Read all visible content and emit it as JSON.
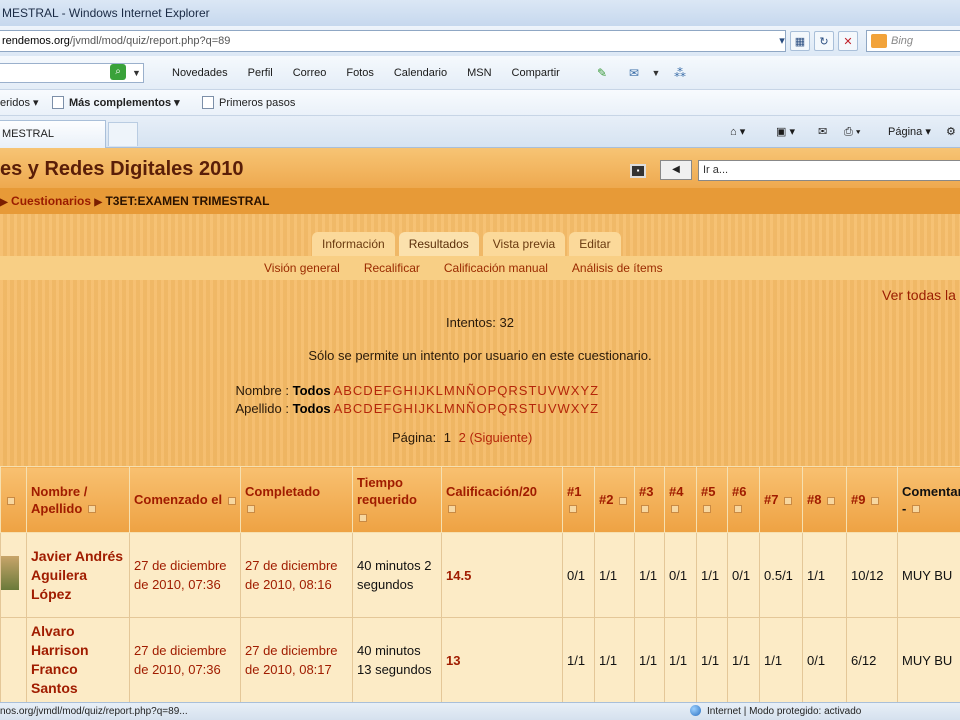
{
  "window": {
    "title": "MESTRAL - Windows Internet Explorer"
  },
  "address": {
    "url_prefix": "",
    "url_host": "rendemos.org",
    "url_path": "/jvmdl/mod/quiz/report.php?q=89",
    "search_placeholder": "Bing"
  },
  "msn_bar": {
    "links": [
      "Novedades",
      "Perfil",
      "Correo",
      "Fotos",
      "Calendario",
      "MSN",
      "Compartir"
    ]
  },
  "favorites": {
    "suggested": "eridos",
    "more_addons": "Más complementos",
    "first_steps": "Primeros pasos"
  },
  "tabs_bar": {
    "active_tab": "MESTRAL",
    "page_menu": "Página"
  },
  "site": {
    "title": "es y Redes Digitales 2010",
    "jump_placeholder": "Ir a..."
  },
  "breadcrumb": {
    "parent": "Cuestionarios",
    "current": "T3ET:EXAMEN TRIMESTRAL"
  },
  "quiz_tabs": [
    "Información",
    "Resultados",
    "Vista previa",
    "Editar"
  ],
  "sub_tabs": [
    "Visión general",
    "Recalificar",
    "Calificación manual",
    "Análisis de ítems"
  ],
  "report": {
    "view_all": "Ver todas la",
    "attempts": "Intentos: 32",
    "notice": "Sólo se permite un intento por usuario en este cuestionario.",
    "first_name_label": "Nombre :",
    "last_name_label": "Apellido :",
    "all_label": "Todos",
    "letters": [
      "A",
      "B",
      "C",
      "D",
      "E",
      "F",
      "G",
      "H",
      "I",
      "J",
      "K",
      "L",
      "M",
      "N",
      "Ñ",
      "O",
      "P",
      "Q",
      "R",
      "S",
      "T",
      "U",
      "V",
      "W",
      "X",
      "Y",
      "Z"
    ],
    "page_label": "Página:",
    "current_page": "1",
    "next_page": "2",
    "next_label": "(Siguiente)"
  },
  "table": {
    "columns": [
      "",
      "Nombre / Apellido",
      "Comenzado el",
      "Completado",
      "Tiempo requerido",
      "Calificación/20",
      "#1",
      "#2",
      "#3",
      "#4",
      "#5",
      "#6",
      "#7",
      "#8",
      "#9",
      "Comentario"
    ],
    "rows": [
      {
        "name": "Javier Andrés Aguilera López",
        "started": "27 de diciembre de 2010, 07:36",
        "completed": "27 de diciembre de 2010, 08:16",
        "duration": "40 minutos 2 segundos",
        "grade": "14.5",
        "q": [
          "0/1",
          "1/1",
          "1/1",
          "0/1",
          "1/1",
          "0/1",
          "0.5/1",
          "1/1",
          "10/12"
        ],
        "comment": "MUY BU"
      },
      {
        "name": "Alvaro Harrison Franco Santos",
        "started": "27 de diciembre de 2010, 07:36",
        "completed": "27 de diciembre de 2010, 08:17",
        "duration": "40 minutos 13 segundos",
        "grade": "13",
        "q": [
          "1/1",
          "1/1",
          "1/1",
          "1/1",
          "1/1",
          "1/1",
          "1/1",
          "0/1",
          "6/12"
        ],
        "comment": "MUY BU"
      }
    ]
  },
  "status": {
    "url": "nos.org/jvmdl/mod/quiz/report.php?q=89...",
    "zone": "Internet | Modo protegido: activado"
  }
}
